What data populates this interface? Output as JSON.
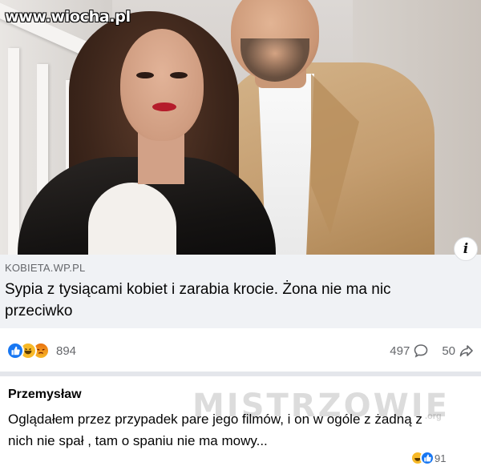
{
  "watermark": "www.wiocha.pl",
  "photo": {
    "description_icon": "couple-photo"
  },
  "info_button": {
    "label": "i"
  },
  "link": {
    "domain": "KOBIETA.WP.PL",
    "title": "Sypia z tysiącami kobiet i zarabia krocie. Żona nie ma nic przeciwko"
  },
  "reactions": {
    "icons": [
      "like-icon",
      "haha-icon",
      "angry-icon"
    ],
    "count": "894"
  },
  "stats": {
    "comments": "497",
    "shares": "50"
  },
  "comment": {
    "author": "Przemysław",
    "text": "Oglądałem przez przypadek pare jego filmów, i on w ogóle z żadną z nich nie spał , tam o spaniu nie ma mowy...",
    "reactions_count": "91"
  },
  "overlay_watermark": {
    "text": "MISTRZOWIE",
    "sub": ".org"
  },
  "colors": {
    "link_bg": "#f0f2f5",
    "secondary_text": "#65676b",
    "like_blue": "#1877f2",
    "haha_yellow": "#f7b928"
  }
}
